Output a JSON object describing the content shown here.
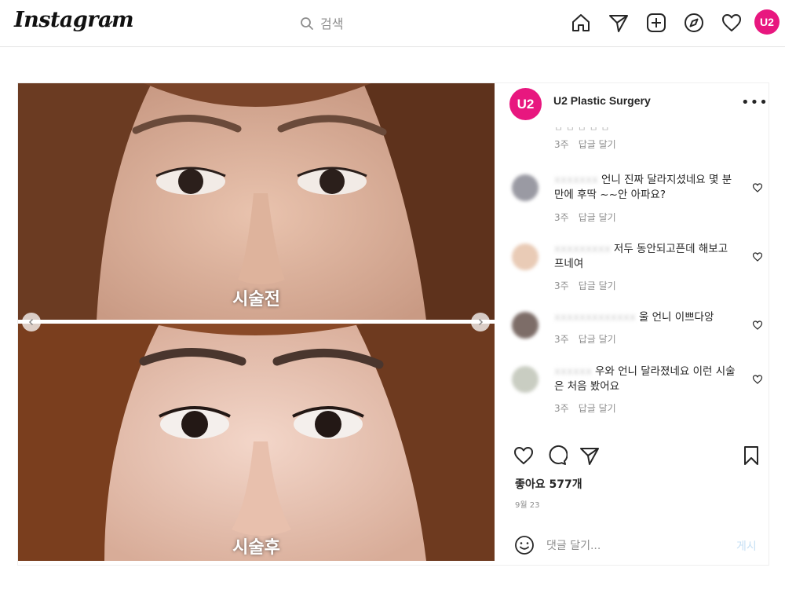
{
  "nav": {
    "logo": "Instagram",
    "search_placeholder": "검색",
    "icons": [
      "home-icon",
      "direct-icon",
      "new-post-icon",
      "explore-icon",
      "activity-heart-icon"
    ],
    "profile_avatar_text": "U2"
  },
  "post": {
    "account_name": "U2 Plastic Surgery",
    "avatar_text": "U2",
    "brand_color": "#e8177f",
    "media": {
      "before_label": "시술전",
      "after_label": "시술후"
    },
    "partial_meta": {
      "time": "3주",
      "reply": "답글 달기"
    },
    "comments": [
      {
        "text": "언니 진짜 달라지셨네요 몇 분 만에 후딱 ~~안 아파요?",
        "time": "3주",
        "reply": "답글 달기",
        "avatar_color": "#9a9aa3"
      },
      {
        "text": "저두 동안되고픈데 해보고 프네여",
        "time": "3주",
        "reply": "답글 달기",
        "avatar_color": "#e9cbb6"
      },
      {
        "text": "울 언니 이쁘다앙",
        "time": "3주",
        "reply": "답글 달기",
        "avatar_color": "#7d6d68"
      },
      {
        "text": "우와 언니 달라졌네요 이런 시술은 처음 봤어요",
        "time": "3주",
        "reply": "답글 달기",
        "avatar_color": "#c9cdc2"
      }
    ],
    "likes": "좋아요 577개",
    "date": "9월 23",
    "comment_placeholder": "댓글 달기...",
    "post_button": "게시"
  }
}
